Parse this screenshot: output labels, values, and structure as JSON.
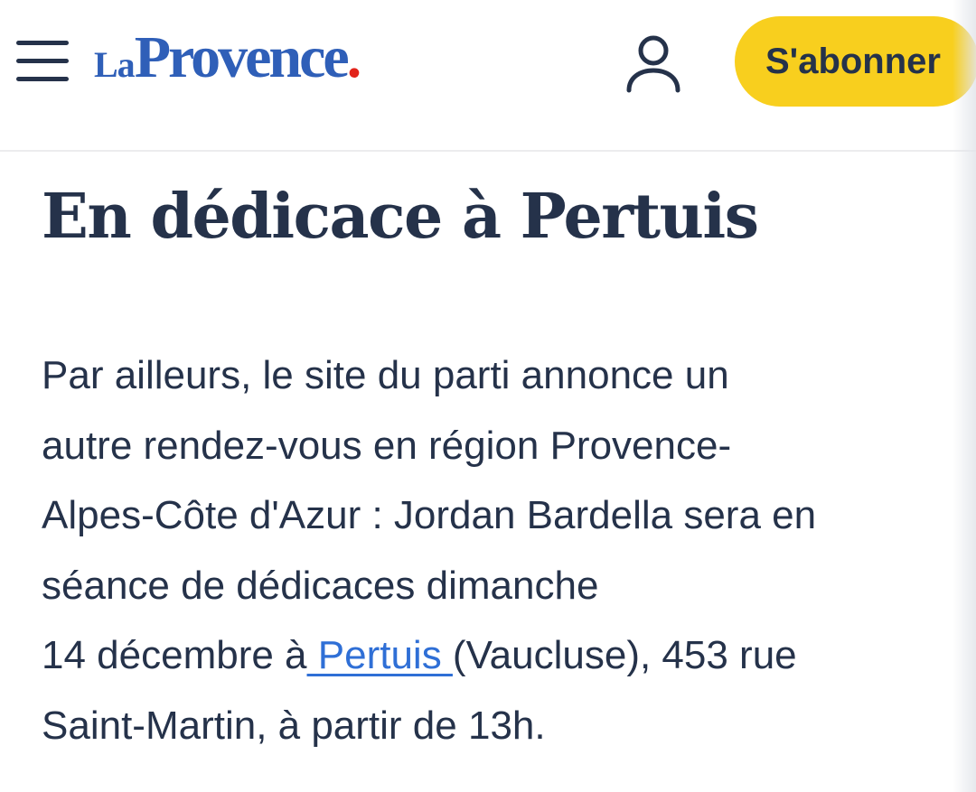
{
  "header": {
    "logo": {
      "prefix": "La",
      "name": "Provence",
      "dot": "."
    },
    "icons": {
      "menu": "hamburger-menu-icon",
      "account": "user-icon"
    },
    "subscribe_label": "S'abonner"
  },
  "article": {
    "headline": "En dédicace à Pertuis",
    "paragraph": {
      "line1": "Par ailleurs, le site du parti annonce un",
      "line2": "autre rendez-vous en région Provence-",
      "line3": "Alpes-Côte d'Azur : Jordan Bardella sera en",
      "line4": "séance de dédicaces dimanche",
      "line5_before_link": "14 décembre à",
      "link_text": " Pertuis ",
      "line5_after_link": "(Vaucluse), 453 rue",
      "line6": "Saint-Martin, à partir de 13h."
    }
  },
  "colors": {
    "text": "#25324a",
    "logo_blue": "#2f5fb8",
    "logo_dot_red": "#e2231a",
    "subscribe_yellow": "#f8cf1e",
    "link_blue": "#2f6fd6"
  }
}
